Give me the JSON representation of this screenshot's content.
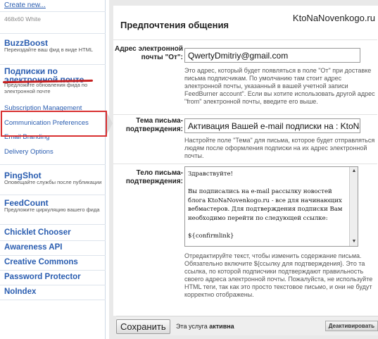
{
  "sidebar": {
    "create_new": "Create new...",
    "badge_size": "468x60 White",
    "buzzboost": {
      "title": "BuzzBoost",
      "desc": "Переиздайте ваш фид в виде HTML"
    },
    "email": {
      "title": "Подписки по электронной почте",
      "desc": "Предложите обновления фида по электронной почте"
    },
    "sub_items": [
      "Subscription Management",
      "Communication Preferences",
      "Email Branding",
      "Delivery Options"
    ],
    "pingshot": {
      "title": "PingShot",
      "desc": "Оповещайте службы после публикации"
    },
    "feedcount": {
      "title": "FeedCount",
      "desc": "Предложите циркуляцию вашего фида"
    },
    "links": [
      "Chicklet Chooser",
      "Awareness API",
      "Creative Commons",
      "Password Protector",
      "NoIndex"
    ]
  },
  "main": {
    "watermark": "KtoNaNovenkogo.ru",
    "title": "Предпочтения общения",
    "from": {
      "label": "Адрес электронной почты \"От\":",
      "value": "QwertyDmitriy@gmail.com",
      "help": "Это адрес, который будет появляться в поле \"От\" при доставке письма подписчикам. По умолчанию там стоит адрес электронной почты, указанный в вашей учетной записи FeedBurner account\". Если вы хотите использовать другой адрес \"from\" электронной почты, введите его выше."
    },
    "subject": {
      "label": "Тема письма-подтверждения:",
      "value": "Активация Вашей e-mail подписки на : KtoNaNovenkogo",
      "help": "Настройте поле \"Тема\" для письма, которое будет отправляться людям после оформления подписки на их адрес электронной почты."
    },
    "body": {
      "label": "Тело письма-подтверждения:",
      "value": "Здравствуйте!\n\nВы подписались на e-mail рассылку новостей блога KtoNaNovenkogo.ru - все для начинающих вебмастеров. Для подтверждения подписки Вам необходимо перейти по следующей ссылке:\n\n${confirmlink}",
      "help": "Отредактируйте текст, чтобы изменить содержание письма. Обязательно включите ${ссылку для подтверждения}. Это та ссылка, по которой подписчики подтверждают правильность своего адреса электронной почты. Пожалуйста, не используйте HTML теги, так как это просто текстовое письмо, и они не будут корректно отображены."
    },
    "footer": {
      "save": "Сохранить",
      "service_prefix": "Эта услуга",
      "service_status": "активна",
      "deactivate": "Деактивировать"
    }
  },
  "colors": {
    "link": "#2a5db0",
    "annotation_red": "#d93030"
  }
}
